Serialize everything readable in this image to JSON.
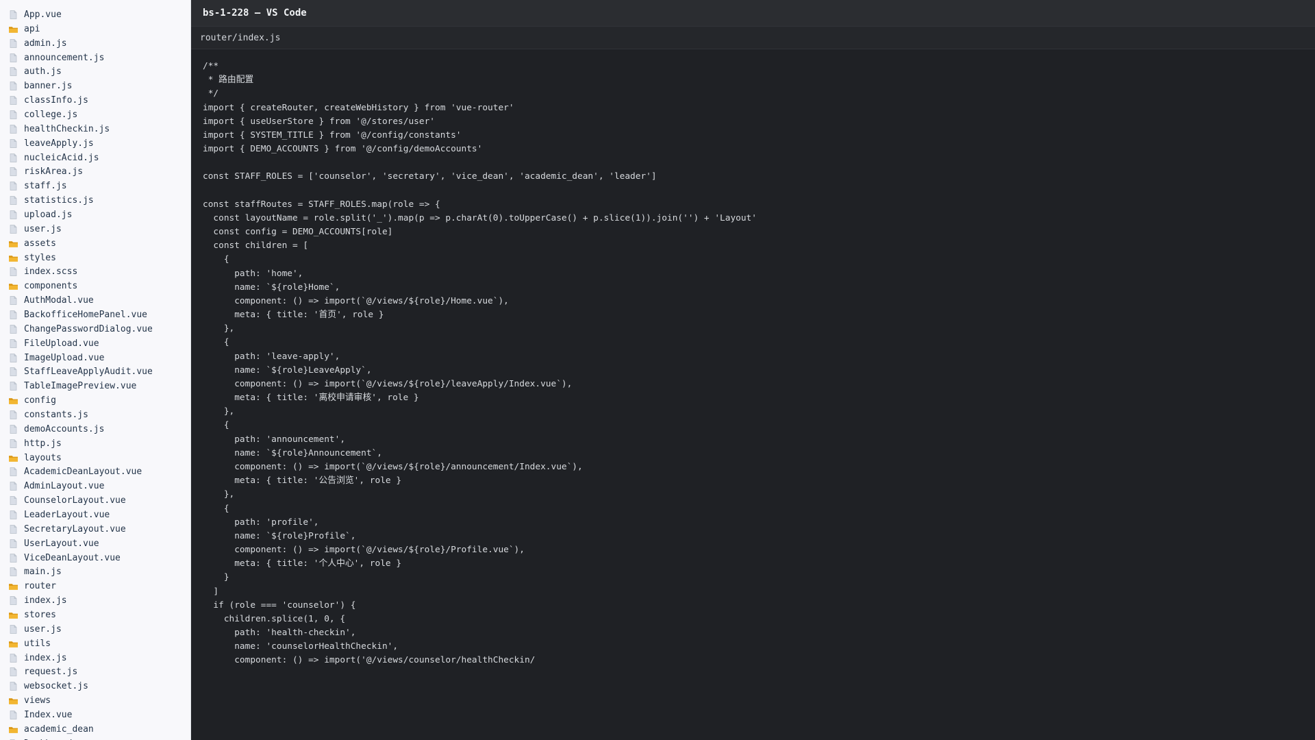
{
  "window": {
    "title": "bs-1-228 — VS Code"
  },
  "editor": {
    "file_path": "router/index.js",
    "lines": [
      "/**",
      " * 路由配置",
      " */",
      "import { createRouter, createWebHistory } from 'vue-router'",
      "import { useUserStore } from '@/stores/user'",
      "import { SYSTEM_TITLE } from '@/config/constants'",
      "import { DEMO_ACCOUNTS } from '@/config/demoAccounts'",
      "",
      "const STAFF_ROLES = ['counselor', 'secretary', 'vice_dean', 'academic_dean', 'leader']",
      "",
      "const staffRoutes = STAFF_ROLES.map(role => {",
      "  const layoutName = role.split('_').map(p => p.charAt(0).toUpperCase() + p.slice(1)).join('') + 'Layout'",
      "  const config = DEMO_ACCOUNTS[role]",
      "  const children = [",
      "    {",
      "      path: 'home',",
      "      name: `${role}Home`,",
      "      component: () => import(`@/views/${role}/Home.vue`),",
      "      meta: { title: '首页', role }",
      "    },",
      "    {",
      "      path: 'leave-apply',",
      "      name: `${role}LeaveApply`,",
      "      component: () => import(`@/views/${role}/leaveApply/Index.vue`),",
      "      meta: { title: '离校申请审核', role }",
      "    },",
      "    {",
      "      path: 'announcement',",
      "      name: `${role}Announcement`,",
      "      component: () => import(`@/views/${role}/announcement/Index.vue`),",
      "      meta: { title: '公告浏览', role }",
      "    },",
      "    {",
      "      path: 'profile',",
      "      name: `${role}Profile`,",
      "      component: () => import(`@/views/${role}/Profile.vue`),",
      "      meta: { title: '个人中心', role }",
      "    }",
      "  ]",
      "  if (role === 'counselor') {",
      "    children.splice(1, 0, {",
      "      path: 'health-checkin',",
      "      name: 'counselorHealthCheckin',",
      "      component: () => import('@/views/counselor/healthCheckin/"
    ]
  },
  "sidebar": {
    "items": [
      {
        "label": "App.vue",
        "type": "file"
      },
      {
        "label": "api",
        "type": "folder"
      },
      {
        "label": "admin.js",
        "type": "file"
      },
      {
        "label": "announcement.js",
        "type": "file"
      },
      {
        "label": "auth.js",
        "type": "file"
      },
      {
        "label": "banner.js",
        "type": "file"
      },
      {
        "label": "classInfo.js",
        "type": "file"
      },
      {
        "label": "college.js",
        "type": "file"
      },
      {
        "label": "healthCheckin.js",
        "type": "file"
      },
      {
        "label": "leaveApply.js",
        "type": "file"
      },
      {
        "label": "nucleicAcid.js",
        "type": "file"
      },
      {
        "label": "riskArea.js",
        "type": "file"
      },
      {
        "label": "staff.js",
        "type": "file"
      },
      {
        "label": "statistics.js",
        "type": "file"
      },
      {
        "label": "upload.js",
        "type": "file"
      },
      {
        "label": "user.js",
        "type": "file"
      },
      {
        "label": "assets",
        "type": "folder"
      },
      {
        "label": "styles",
        "type": "folder"
      },
      {
        "label": "index.scss",
        "type": "file"
      },
      {
        "label": "components",
        "type": "folder"
      },
      {
        "label": "AuthModal.vue",
        "type": "file"
      },
      {
        "label": "BackofficeHomePanel.vue",
        "type": "file"
      },
      {
        "label": "ChangePasswordDialog.vue",
        "type": "file"
      },
      {
        "label": "FileUpload.vue",
        "type": "file"
      },
      {
        "label": "ImageUpload.vue",
        "type": "file"
      },
      {
        "label": "StaffLeaveApplyAudit.vue",
        "type": "file"
      },
      {
        "label": "TableImagePreview.vue",
        "type": "file"
      },
      {
        "label": "config",
        "type": "folder"
      },
      {
        "label": "constants.js",
        "type": "file"
      },
      {
        "label": "demoAccounts.js",
        "type": "file"
      },
      {
        "label": "http.js",
        "type": "file"
      },
      {
        "label": "layouts",
        "type": "folder"
      },
      {
        "label": "AcademicDeanLayout.vue",
        "type": "file"
      },
      {
        "label": "AdminLayout.vue",
        "type": "file"
      },
      {
        "label": "CounselorLayout.vue",
        "type": "file"
      },
      {
        "label": "LeaderLayout.vue",
        "type": "file"
      },
      {
        "label": "SecretaryLayout.vue",
        "type": "file"
      },
      {
        "label": "UserLayout.vue",
        "type": "file"
      },
      {
        "label": "ViceDeanLayout.vue",
        "type": "file"
      },
      {
        "label": "main.js",
        "type": "file"
      },
      {
        "label": "router",
        "type": "folder"
      },
      {
        "label": "index.js",
        "type": "file"
      },
      {
        "label": "stores",
        "type": "folder"
      },
      {
        "label": "user.js",
        "type": "file"
      },
      {
        "label": "utils",
        "type": "folder"
      },
      {
        "label": "index.js",
        "type": "file"
      },
      {
        "label": "request.js",
        "type": "file"
      },
      {
        "label": "websocket.js",
        "type": "file"
      },
      {
        "label": "views",
        "type": "folder"
      },
      {
        "label": "Index.vue",
        "type": "file"
      },
      {
        "label": "academic_dean",
        "type": "folder"
      },
      {
        "label": "Dashboard.vue",
        "type": "file"
      }
    ]
  },
  "icons": {
    "file": "file-icon",
    "folder": "folder-icon"
  },
  "colors": {
    "sidebar_background": "#f8f8fb",
    "editor_background": "#1f2125",
    "titlebar_background": "#2b2d31",
    "folder_icon": "#f2b632",
    "file_icon": "#d9dee7"
  }
}
